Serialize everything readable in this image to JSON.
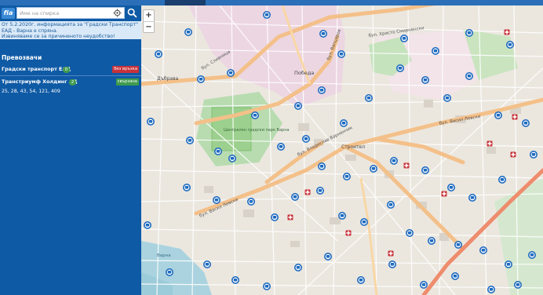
{
  "search": {
    "placeholder": "Име на спирка"
  },
  "logo": {
    "text": "fia"
  },
  "notice": {
    "line1": "От 5.2.2020г. информацията за \"Градски Транспорт\"",
    "line2": "ЕАД - Варна е спряна.",
    "line3": "Извиняваме се за причиненото неудобство!"
  },
  "carriers": {
    "title": "Превозвачи",
    "items": [
      {
        "name": "Градски транспорт ЕАД",
        "count": "0",
        "status": "без връзка",
        "status_color": "#c8323a"
      },
      {
        "name": "Транстриумф Холдинг АД",
        "count": "2",
        "status": "свързана",
        "status_color": "#3f9b4e"
      }
    ],
    "routes": "25, 28, 43, 54, 121, 409"
  },
  "zoom": {
    "in": "+",
    "out": "−"
  },
  "map": {
    "labels": {
      "hristo_smirnenski": "бул. Христо Смирненски",
      "saborni": "бул. Сливница",
      "pobeda": "Победа",
      "vaptsarov": "бул. Вапцаров",
      "stadium": "Централен градски парк Варна",
      "vladislav": "бул. Владислав Варненчик",
      "vasil_levski_1": "бул. Васил Левски",
      "vasil_levski_2": "бул. Васил Левски",
      "dubrava": "Дъбрава",
      "stroitel": "Строител",
      "varna": "Варна"
    }
  },
  "colors": {
    "sidebar": "#0f5aa5",
    "stop_icon": "#1e6bc0",
    "accent_red": "#c8323a",
    "accent_green": "#3f9b4e"
  },
  "icons": [
    "search-icon",
    "locate-icon",
    "bus-stop-icon",
    "hospital-icon"
  ]
}
